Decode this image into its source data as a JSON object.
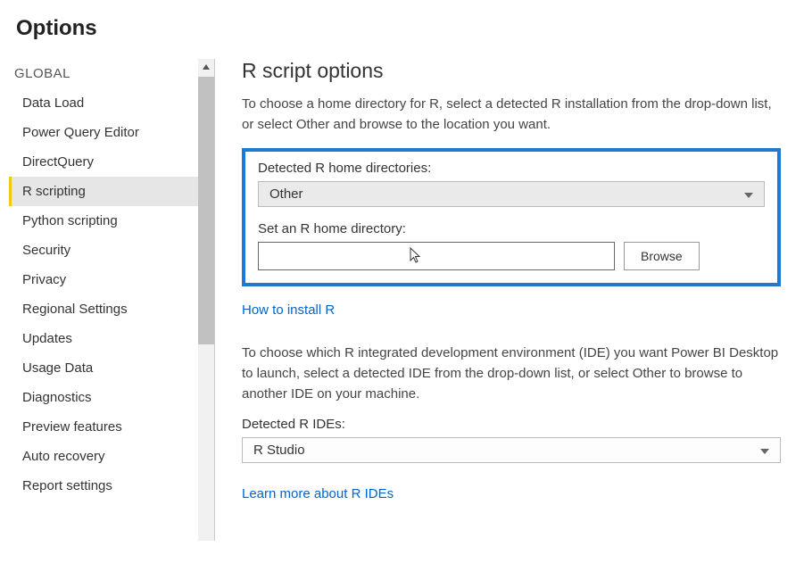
{
  "window": {
    "title": "Options"
  },
  "sidebar": {
    "section_label": "GLOBAL",
    "selected_index": 3,
    "items": [
      {
        "label": "Data Load"
      },
      {
        "label": "Power Query Editor"
      },
      {
        "label": "DirectQuery"
      },
      {
        "label": "R scripting"
      },
      {
        "label": "Python scripting"
      },
      {
        "label": "Security"
      },
      {
        "label": "Privacy"
      },
      {
        "label": "Regional Settings"
      },
      {
        "label": "Updates"
      },
      {
        "label": "Usage Data"
      },
      {
        "label": "Diagnostics"
      },
      {
        "label": "Preview features"
      },
      {
        "label": "Auto recovery"
      },
      {
        "label": "Report settings"
      }
    ]
  },
  "content": {
    "title": "R script options",
    "intro": "To choose a home directory for R, select a detected R installation from the drop-down list, or select Other and browse to the location you want.",
    "home_label": "Detected R home directories:",
    "home_selected": "Other",
    "set_home_label": "Set an R home directory:",
    "set_home_value": "",
    "browse_label": "Browse",
    "install_link": "How to install R",
    "ide_intro": "To choose which R integrated development environment (IDE) you want Power BI Desktop to launch, select a detected IDE from the drop-down list, or select Other to browse to another IDE on your machine.",
    "ide_label": "Detected R IDEs:",
    "ide_selected": "R Studio",
    "ide_link": "Learn more about R IDEs"
  }
}
